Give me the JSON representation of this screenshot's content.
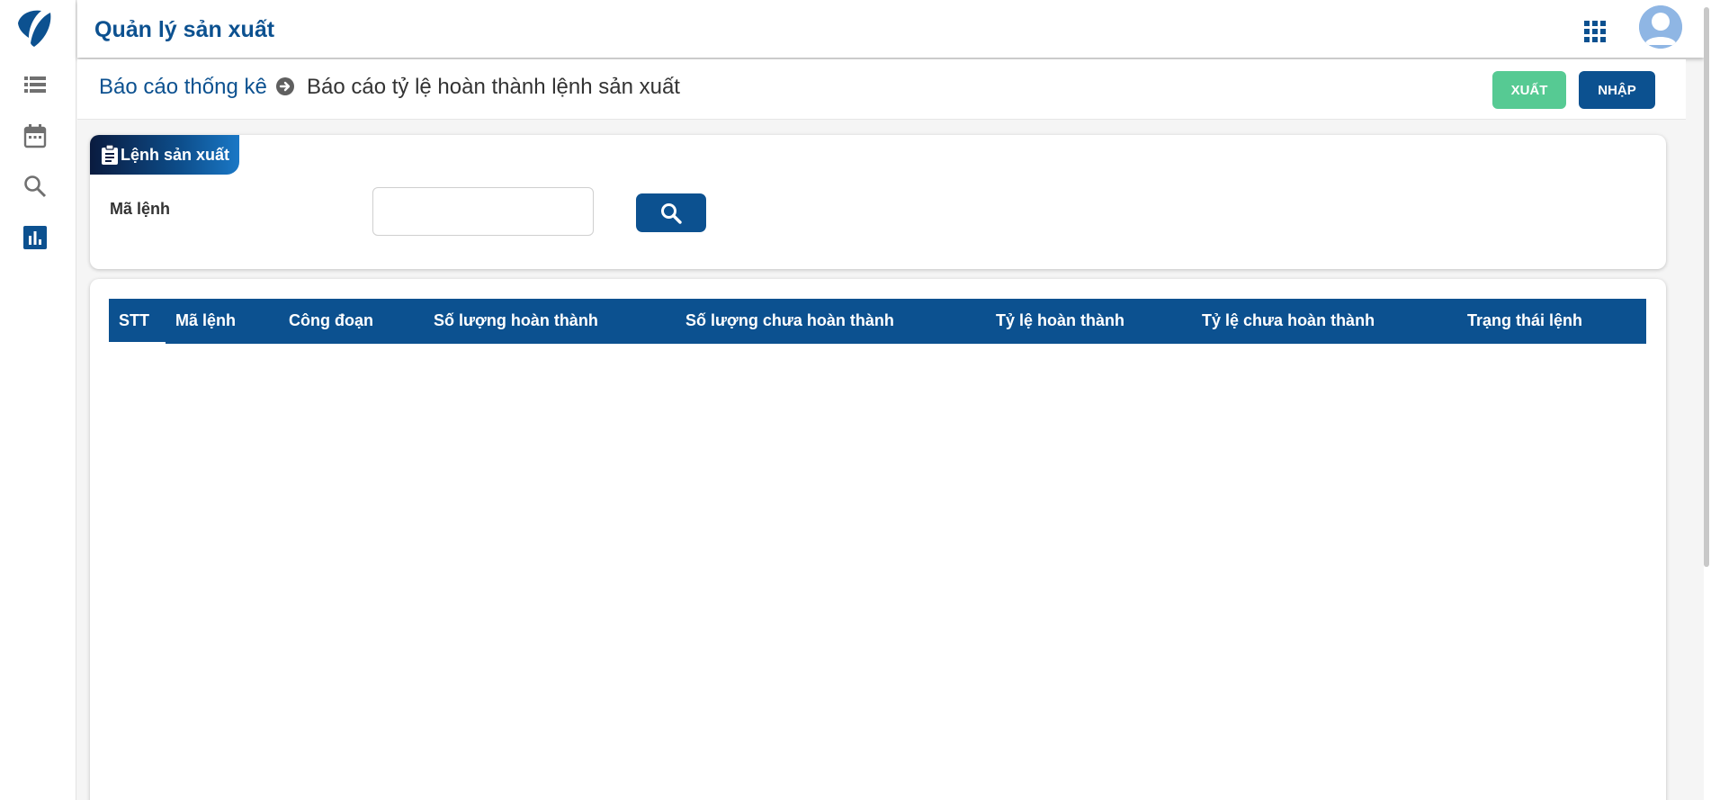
{
  "app": {
    "title": "Quản lý sản xuất"
  },
  "sidebar": {
    "items": [
      {
        "icon": "list-icon"
      },
      {
        "icon": "calendar-icon"
      },
      {
        "icon": "search-icon"
      },
      {
        "icon": "bar-chart-icon",
        "active": true
      }
    ]
  },
  "breadcrumb": {
    "parent": "Báo cáo thống kê",
    "current": "Báo cáo tỷ lệ hoàn thành lệnh sản xuất"
  },
  "actions": {
    "export_label": "XUẤT",
    "import_label": "NHẬP"
  },
  "filter": {
    "tab_label": "Lệnh sản xuất",
    "order_code_label": "Mã lệnh",
    "order_code_value": "",
    "order_code_placeholder": ""
  },
  "table": {
    "columns": [
      "STT",
      "Mã lệnh",
      "Công đoạn",
      "Số lượng hoàn thành",
      "Số lượng chưa hoàn thành",
      "Tỷ lệ hoàn thành",
      "Tỷ lệ chưa hoàn thành",
      "Trạng thái lệnh"
    ],
    "rows": []
  },
  "colors": {
    "primary": "#0c5190",
    "export_green": "#56ca93",
    "sidebar_icon": "#707070",
    "avatar": "#8fb6e4"
  }
}
